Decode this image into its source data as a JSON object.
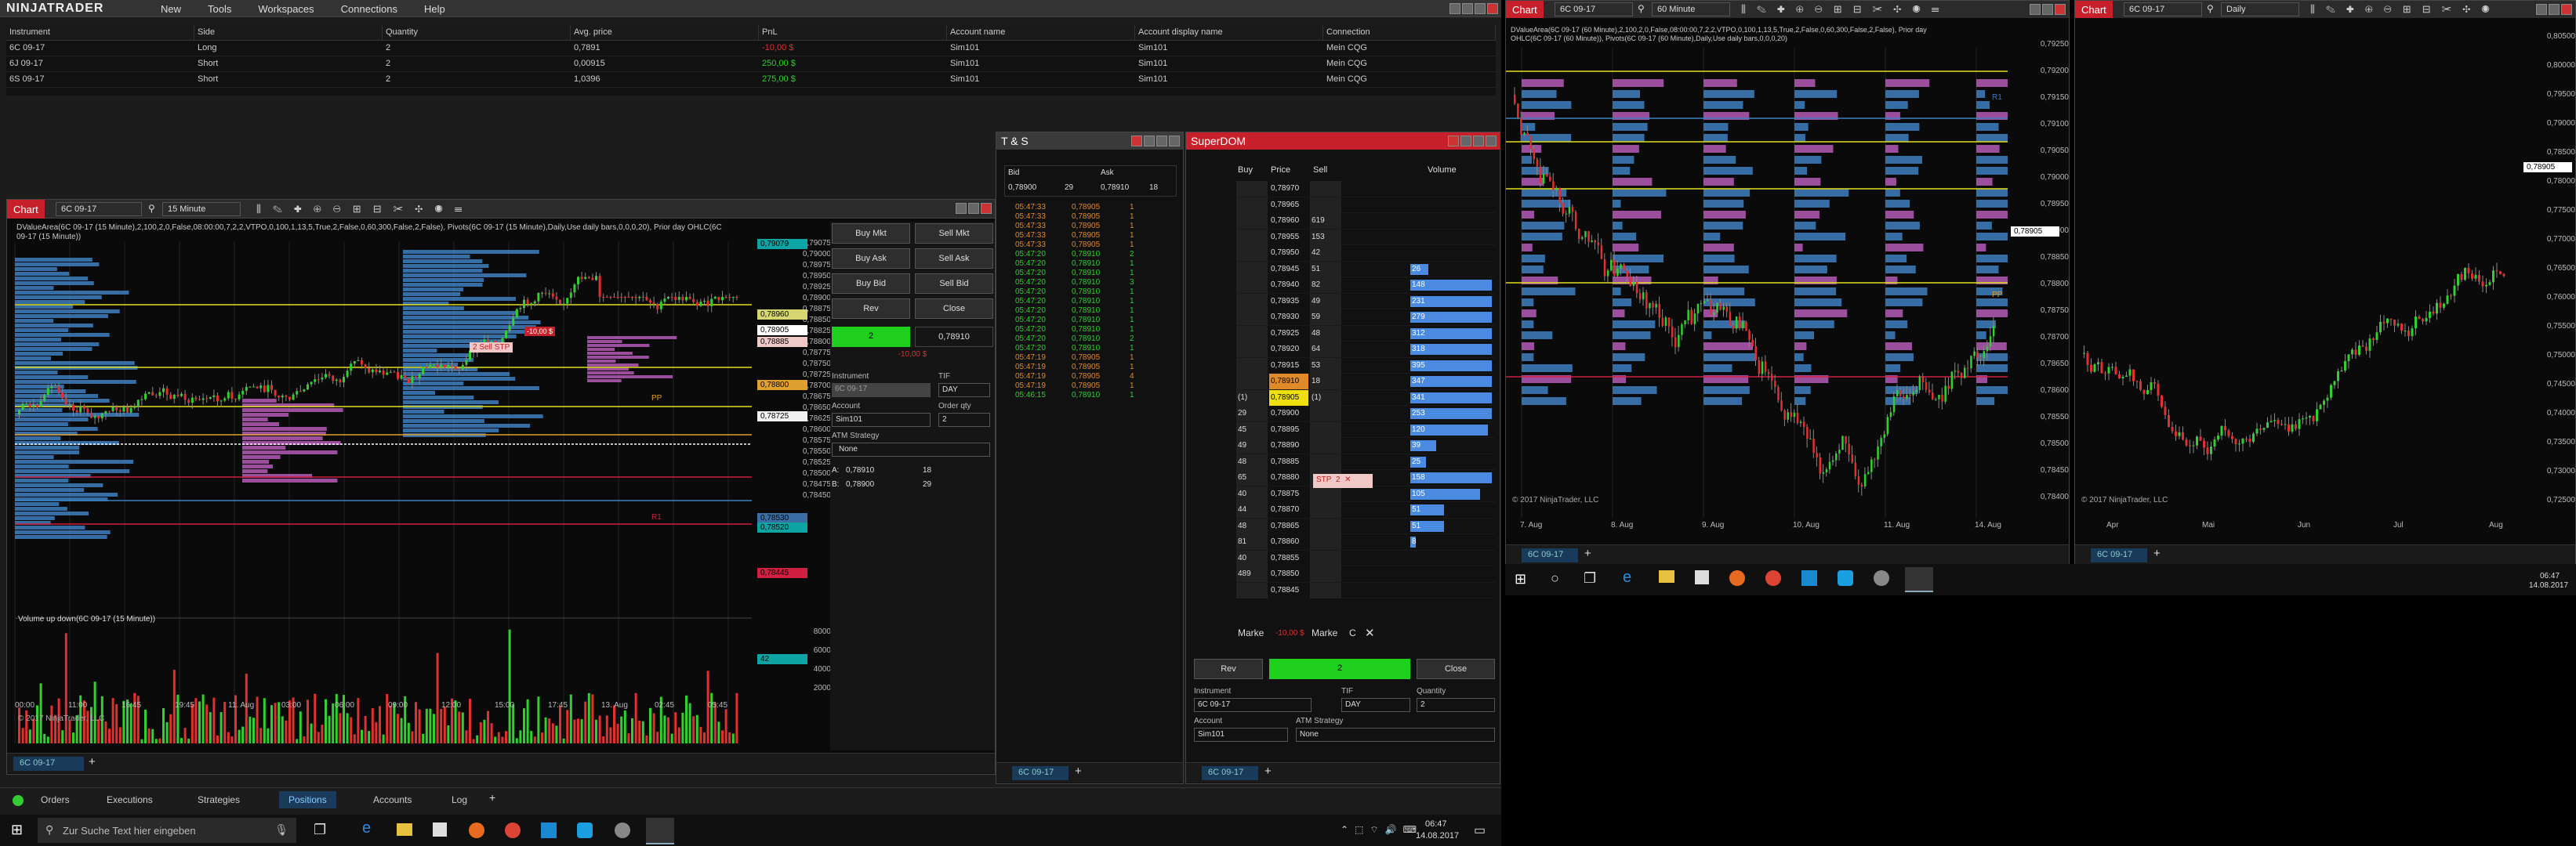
{
  "control": {
    "logo": "NINJATRADER",
    "menu": [
      "New",
      "Tools",
      "Workspaces",
      "Connections",
      "Help"
    ],
    "positions_headers": [
      "Instrument",
      "Side",
      "Quantity",
      "Avg. price",
      "PnL",
      "Account name",
      "Account display name",
      "Connection"
    ],
    "positions": [
      [
        "6C 09-17",
        "Long",
        "2",
        "0,7891",
        "-10,00 $",
        "Sim101",
        "Sim101",
        "Mein CQG"
      ],
      [
        "6J 09-17",
        "Short",
        "2",
        "0,00915",
        "250,00 $",
        "Sim101",
        "Sim101",
        "Mein CQG"
      ],
      [
        "6S 09-17",
        "Short",
        "2",
        "1,0396",
        "275,00 $",
        "Sim101",
        "Sim101",
        "Mein CQG"
      ]
    ],
    "tabs": [
      "Orders",
      "Executions",
      "Strategies",
      "Positions",
      "Accounts",
      "Log"
    ],
    "add_tab": "+"
  },
  "colors": {
    "up": "#2fd02f",
    "down": "#e03030",
    "profile": "#3d7fc0",
    "profile2": "#b55ab5",
    "level": "#e0e020",
    "accent": "#1a73b8"
  },
  "chart1": {
    "tab": "Chart",
    "instrument": "6C 09-17",
    "interval": "15 Minute",
    "info": "DValueArea(6C 09-17 (15 Minute),2,100,2,0,False,08:00:00,7,2,2,VTPO,0,100,1,13,5,True,2,False,0,60,300,False,2,False), Pivots(6C 09-17 (15 Minute),Daily,Use daily bars,0,0,0,20), Prior day OHLC(6C",
    "info2": "09-17 (15 Minute))",
    "copyright": "© 2017 NinjaTrader, LLC",
    "vol_title": "Volume up down(6C 09-17 (15 Minute))",
    "sell_stp": "2 Sell STP",
    "order_qty_tag": "-10,00 $",
    "price_ticks": [
      "0,79075",
      "0,79000",
      "0,78975",
      "0,78950",
      "0,78925",
      "0,78900",
      "0,78875",
      "0,78850",
      "0,78825",
      "0,78800",
      "0,78775",
      "0,78750",
      "0,78725",
      "0,78700",
      "0,78675",
      "0,78650",
      "0,78625",
      "0,78600",
      "0,78575",
      "0,78550",
      "0,78525",
      "0,78500",
      "0,78475",
      "0,78450"
    ],
    "price_tags": [
      {
        "t": "0,79079",
        "c": "#0fa4a4"
      },
      {
        "t": "0,78960",
        "c": "#d6d670"
      },
      {
        "t": "0,78905",
        "c": "#ffffff"
      },
      {
        "t": "0,78885",
        "c": "#f0c8c8"
      },
      {
        "t": "0,78800",
        "c": "#e0a030"
      },
      {
        "t": "0,78725",
        "c": "#f0f0f0"
      },
      {
        "t": "0,78530",
        "c": "#3b6ea5"
      },
      {
        "t": "0,78520",
        "c": "#0fa4a4"
      },
      {
        "t": "0,78445",
        "c": "#d02040"
      },
      {
        "t": "42",
        "c": "#0fa4a4"
      }
    ],
    "vol_ticks": [
      "8000",
      "6000",
      "4000",
      "2000"
    ],
    "time_ticks": [
      "00:00",
      "11:00",
      "16:45",
      "19:45",
      "11. Aug",
      "03:00",
      "06:00",
      "09:00",
      "12:00",
      "15:00",
      "17:45",
      "13. Aug",
      "02:45",
      "05:45"
    ],
    "pp": "PP",
    "r1": "R1",
    "tab_bottom": "6C 09-17",
    "add": "+"
  },
  "order": {
    "buy_mkt": "Buy Mkt",
    "sell_mkt": "Sell Mkt",
    "buy_ask": "Buy Ask",
    "sell_ask": "Sell Ask",
    "buy_bid": "Buy Bid",
    "sell_bid": "Sell Bid",
    "rev": "Rev",
    "close": "Close",
    "pos_qty": "2",
    "pos_price": "0,78910",
    "pnl": "-10,00 $",
    "instrument_lbl": "Instrument",
    "tif_lbl": "TIF",
    "instrument": "6C 09-17",
    "tif": "DAY",
    "account_lbl": "Account",
    "orderqty_lbl": "Order qty",
    "account": "Sim101",
    "qty": "2",
    "atm_lbl": "ATM Strategy",
    "atm": "None",
    "a": "A:",
    "b": "B:",
    "a_price": "0,78910",
    "a_size": "18",
    "b_price": "0,78900",
    "b_size": "29"
  },
  "ts": {
    "title": "T & S",
    "bid": "Bid",
    "ask": "Ask",
    "bid_price": "0,78900",
    "bid_size": "29",
    "ask_price": "0,78910",
    "ask_size": "18",
    "tab": "6C 09-17",
    "add": "+",
    "rows": [
      [
        "05:47:33",
        "0,78905",
        "1",
        "o"
      ],
      [
        "05:47:33",
        "0,78905",
        "1",
        "o"
      ],
      [
        "05:47:33",
        "0,78905",
        "1",
        "o"
      ],
      [
        "05:47:33",
        "0,78905",
        "1",
        "o"
      ],
      [
        "05:47:33",
        "0,78905",
        "1",
        "o"
      ],
      [
        "05:47:20",
        "0,78910",
        "2",
        "g"
      ],
      [
        "05:47:20",
        "0,78910",
        "1",
        "g"
      ],
      [
        "05:47:20",
        "0,78910",
        "1",
        "g"
      ],
      [
        "05:47:20",
        "0,78910",
        "3",
        "g"
      ],
      [
        "05:47:20",
        "0,78910",
        "1",
        "g"
      ],
      [
        "05:47:20",
        "0,78910",
        "1",
        "g"
      ],
      [
        "05:47:20",
        "0,78910",
        "1",
        "g"
      ],
      [
        "05:47:20",
        "0,78910",
        "1",
        "g"
      ],
      [
        "05:47:20",
        "0,78910",
        "1",
        "g"
      ],
      [
        "05:47:20",
        "0,78910",
        "2",
        "g"
      ],
      [
        "05:47:20",
        "0,78910",
        "1",
        "g"
      ],
      [
        "05:47:19",
        "0,78905",
        "1",
        "o"
      ],
      [
        "05:47:19",
        "0,78905",
        "1",
        "o"
      ],
      [
        "05:47:19",
        "0,78905",
        "4",
        "o"
      ],
      [
        "05:47:19",
        "0,78905",
        "1",
        "o"
      ],
      [
        "05:46:15",
        "0,78910",
        "1",
        "g"
      ]
    ]
  },
  "dom": {
    "title": "SuperDOM",
    "buy": "Buy",
    "price": "Price",
    "sell": "Sell",
    "volume": "Volume",
    "market_l": "Marke",
    "market_r": "Marke",
    "c": "C",
    "pnl": "-10,00 $",
    "rev": "Rev",
    "pos_qty": "2",
    "close": "Close",
    "instrument_lbl": "Instrument",
    "tif_lbl": "TIF",
    "qty_lbl": "Quantity",
    "instrument": "6C 09-17",
    "tif": "DAY",
    "qty": "2",
    "account_lbl": "Account",
    "atm_lbl": "ATM Strategy",
    "account": "Sim101",
    "atm": "None",
    "tab": "6C 09-17",
    "add": "+",
    "stp": "STP",
    "stp_qty": "2",
    "rows": [
      [
        "",
        "0,78970",
        "",
        ""
      ],
      [
        "",
        "0,78965",
        "",
        ""
      ],
      [
        "",
        "0,78960",
        "619",
        ""
      ],
      [
        "",
        "0,78955",
        "153",
        ""
      ],
      [
        "",
        "0,78950",
        "42",
        ""
      ],
      [
        "",
        "0,78945",
        "51",
        "26"
      ],
      [
        "",
        "0,78940",
        "82",
        "148"
      ],
      [
        "",
        "0,78935",
        "49",
        "231"
      ],
      [
        "",
        "0,78930",
        "59",
        "279"
      ],
      [
        "",
        "0,78925",
        "48",
        "312"
      ],
      [
        "",
        "0,78920",
        "64",
        "318"
      ],
      [
        "",
        "0,78915",
        "53",
        "395"
      ],
      [
        "",
        "0,78910",
        "18",
        "347"
      ],
      [
        "(1)",
        "0,78905",
        "(1)",
        "341"
      ],
      [
        "29",
        "0,78900",
        "",
        "253"
      ],
      [
        "45",
        "0,78895",
        "",
        "120"
      ],
      [
        "49",
        "0,78890",
        "",
        "39"
      ],
      [
        "48",
        "0,78885",
        "",
        "25"
      ],
      [
        "65",
        "0,78880",
        "",
        "158"
      ],
      [
        "40",
        "0,78875",
        "",
        "105"
      ],
      [
        "44",
        "0,78870",
        "",
        "51"
      ],
      [
        "48",
        "0,78865",
        "",
        "51"
      ],
      [
        "81",
        "0,78860",
        "",
        "8"
      ],
      [
        "40",
        "0,78855",
        "",
        ""
      ],
      [
        "489",
        "0,78850",
        "",
        ""
      ],
      [
        "",
        "0,78845",
        "",
        ""
      ]
    ]
  },
  "chart2": {
    "tab": "Chart",
    "instrument": "6C 09-17",
    "interval": "60 Minute",
    "info": "DValueArea(6C 09-17 (60 Minute),2,100,2,0,False,08:00:00,7,2,2,VTPO,0,100,1,13,5,True,2,False,0,60,300,False,2,False), Prior day",
    "info2": "OHLC(6C 09-17 (60 Minute)), Pivots(6C 09-17 (60 Minute),Daily,Use daily bars,0,0,0,20)",
    "copyright": "© 2017 NinjaTrader, LLC",
    "tag": "0,78905",
    "tab_bottom": "6C 09-17",
    "add": "+",
    "price_ticks": [
      "0,79250",
      "0,79200",
      "0,79150",
      "0,79100",
      "0,79050",
      "0,79000",
      "0,78950",
      "0,78900",
      "0,78850",
      "0,78800",
      "0,78750",
      "0,78700",
      "0,78650",
      "0,78600",
      "0,78550",
      "0,78500",
      "0,78450",
      "0,78400"
    ],
    "time_ticks": [
      "7. Aug",
      "8. Aug",
      "9. Aug",
      "10. Aug",
      "11. Aug",
      "14. Aug"
    ],
    "r1": "R1",
    "pp": "PP"
  },
  "chart3": {
    "tab": "Chart",
    "instrument": "6C 09-17",
    "interval": "Daily",
    "copyright": "© 2017 NinjaTrader, LLC",
    "tag": "0,78905",
    "tab_bottom": "6C 09-17",
    "add": "+",
    "price_ticks": [
      "0,80500",
      "0,80000",
      "0,79500",
      "0,79000",
      "0,78500",
      "0,78000",
      "0,77500",
      "0,77000",
      "0,76500",
      "0,76000",
      "0,75500",
      "0,75000",
      "0,74500",
      "0,74000",
      "0,73500",
      "0,73000",
      "0,72500"
    ],
    "time_ticks": [
      "Apr",
      "Mai",
      "Jun",
      "Jul",
      "Aug"
    ]
  },
  "taskbar": {
    "search": "Zur Suche Text hier eingeben",
    "time": "06:47",
    "date": "14.08.2017"
  }
}
